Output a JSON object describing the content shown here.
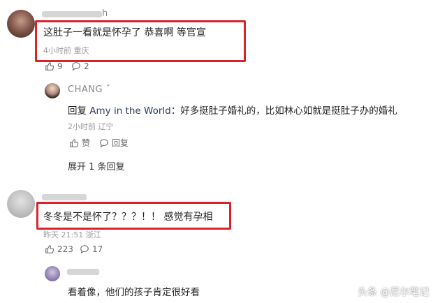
{
  "comments": [
    {
      "username": "h",
      "text": "这肚子一看就是怀孕了 恭喜啊 等官宣",
      "meta_time": "4小时前",
      "meta_location": "重庆",
      "likes": "9",
      "replies": "2"
    },
    {
      "text": "冬冬是不是怀了？？？！！ 感觉有孕相",
      "meta_time": "昨天 21:51",
      "meta_location": "浙江",
      "likes": "223",
      "replies": "17"
    },
    {
      "text": "看着像，他们的孩子肯定很好看"
    }
  ],
  "reply": {
    "username": "CHANG ˇ",
    "prefix": "回复",
    "target": "Amy in the World",
    "colon": "：",
    "text": "好多挺肚子婚礼的，比如林心如就是挺肚子办的婚礼",
    "meta_time": "2小时前",
    "meta_location": "辽宁",
    "like_label": "赞",
    "reply_label": "回复"
  },
  "expand_label": "展开 1 条回复",
  "watermark": "头条 @尼尔笔记",
  "colors": {
    "highlight_frame": "#d8232a",
    "link": "#2b3b6a",
    "meta": "#9a9a9a"
  }
}
